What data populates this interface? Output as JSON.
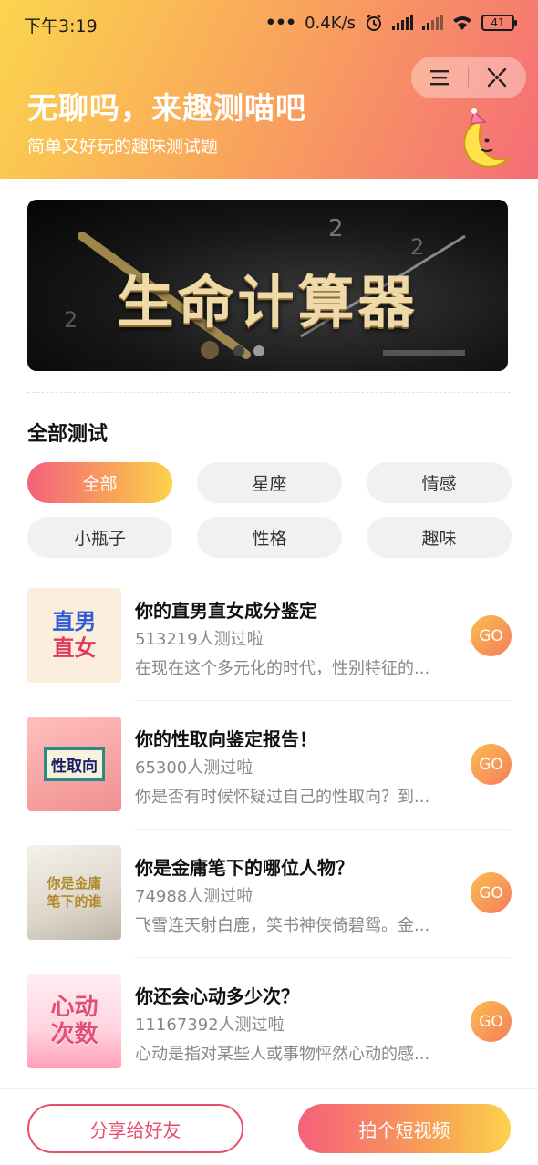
{
  "status_bar": {
    "time": "下午3:19",
    "network_speed": "0.4K/s",
    "battery": "41"
  },
  "header": {
    "title": "无聊吗，来趣测喵吧",
    "subtitle": "简单又好玩的趣味测试题"
  },
  "capsule": {
    "menu_icon": "menu-icon",
    "close_icon": "close-target-icon"
  },
  "banner": {
    "title": "生命计算器",
    "slides": 2,
    "active_slide": 2
  },
  "section": {
    "title": "全部测试"
  },
  "categories": [
    {
      "label": "全部",
      "active": true
    },
    {
      "label": "星座",
      "active": false
    },
    {
      "label": "情感",
      "active": false
    },
    {
      "label": "小瓶子",
      "active": false
    },
    {
      "label": "性格",
      "active": false
    },
    {
      "label": "趣味",
      "active": false
    }
  ],
  "tests": [
    {
      "title": "你的直男直女成分鉴定",
      "count": "513219人测过啦",
      "desc": "在现在这个多元化的时代，性别特征的...",
      "thumb_lines": [
        "直男",
        "直女"
      ],
      "go": "GO"
    },
    {
      "title": "你的性取向鉴定报告！",
      "count": "65300人测过啦",
      "desc": "你是否有时候怀疑过自己的性取向？到...",
      "thumb_lines": [
        "性取向"
      ],
      "go": "GO"
    },
    {
      "title": "你是金庸笔下的哪位人物？",
      "count": "74988人测过啦",
      "desc": "飞雪连天射白鹿，笑书神侠倚碧鸳。金...",
      "thumb_lines": [
        "你是金庸",
        "笔下的谁"
      ],
      "go": "GO"
    },
    {
      "title": "你还会心动多少次？",
      "count": "11167392人测过啦",
      "desc": "心动是指对某些人或事物怦然心动的感...",
      "thumb_lines": [
        "心动",
        "次数"
      ],
      "go": "GO"
    }
  ],
  "bottom_bar": {
    "share_label": "分享给好友",
    "video_label": "拍个短视频"
  },
  "colors": {
    "accent_pink": "#f5607b",
    "accent_yellow": "#fcd24c",
    "share_border": "#e7506d"
  }
}
